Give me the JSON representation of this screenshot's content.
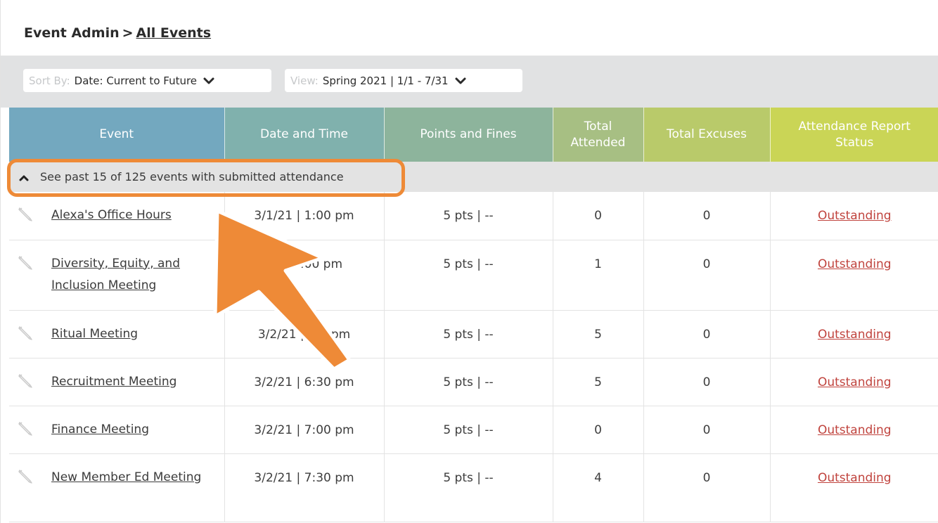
{
  "breadcrumb": {
    "parent": "Event Admin",
    "separator": ">",
    "current": "All Events"
  },
  "toolbar": {
    "sort": {
      "label": "Sort By:",
      "value": "Date: Current to Future"
    },
    "view": {
      "label": "View:",
      "value": "Spring 2021 | 1/1 - 7/31"
    }
  },
  "table": {
    "headers": {
      "event": "Event",
      "date": "Date and Time",
      "points": "Points and Fines",
      "attended": "Total Attended",
      "excuses": "Total Excuses",
      "status": "Attendance Report Status"
    },
    "past_toggle": "See past 15 of 125 events with submitted attendance",
    "rows": [
      {
        "name": "Alexa's Office Hours",
        "datetime": "3/1/21 | 1:00 pm",
        "points": "5 pts | --",
        "attended": "0",
        "excuses": "0",
        "status": "Outstanding"
      },
      {
        "name": "Diversity, Equity, and Inclusion Meeting",
        "datetime": "21 | 6:00 pm",
        "points": "5 pts | --",
        "attended": "1",
        "excuses": "0",
        "status": "Outstanding"
      },
      {
        "name": "Ritual Meeting",
        "datetime": "3/2/21 | :00 pm",
        "points": "5 pts | --",
        "attended": "5",
        "excuses": "0",
        "status": "Outstanding"
      },
      {
        "name": "Recruitment Meeting",
        "datetime": "3/2/21 | 6:30 pm",
        "points": "5 pts | --",
        "attended": "5",
        "excuses": "0",
        "status": "Outstanding"
      },
      {
        "name": "Finance Meeting",
        "datetime": "3/2/21 | 7:00 pm",
        "points": "5 pts | --",
        "attended": "0",
        "excuses": "0",
        "status": "Outstanding"
      },
      {
        "name": "New Member Ed Meeting",
        "datetime": "3/2/21 | 7:30 pm",
        "points": "5 pts | --",
        "attended": "4",
        "excuses": "0",
        "status": "Outstanding"
      }
    ]
  },
  "annotation": {
    "color": "#ee8a37"
  },
  "colors": {
    "header_event": "#73a8bf",
    "header_date": "#80b1ad",
    "header_points": "#8db49c",
    "header_attended": "#a7bf83",
    "header_excuses": "#b9ca6a",
    "header_status": "#cad556",
    "status_link": "#c0433d"
  }
}
